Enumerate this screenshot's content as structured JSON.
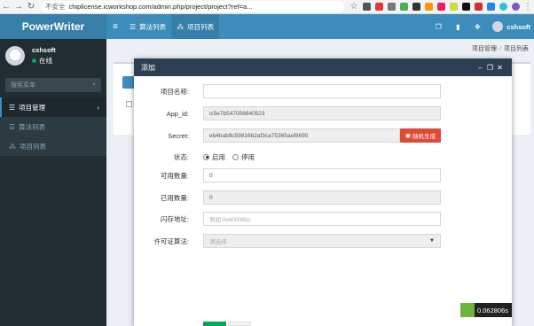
{
  "browser": {
    "security_label": "不安全",
    "url": "chiplicense.icworkshop.com/admin.php/project/project?ref=a..."
  },
  "sidebar": {
    "logo": "PowerWriter",
    "user_name": "cshsoft",
    "user_status": "在线",
    "search_placeholder": "搜索菜单",
    "menu": {
      "project_mgmt": "项目管理",
      "algo_list": "算法列表",
      "project_list": "项目列表"
    }
  },
  "topbar": {
    "tab_algo": "算法列表",
    "tab_project": "项目列表",
    "user": "cshsoft"
  },
  "breadcrumb": {
    "level1": "项目管理",
    "level2": "项目列表"
  },
  "modal": {
    "title": "添加",
    "fields": {
      "project_name_label": "项目名称:",
      "project_name_value": "",
      "app_id_label": "App_id:",
      "app_id_value": "ic5e7b547056840523",
      "secret_label": "Secret:",
      "secret_value": "eb4bab9c59816b2af3ca75365aef8695",
      "random_btn": "随机生成",
      "status_label": "状态:",
      "status_on": "启用",
      "status_off": "停用",
      "available_label": "可用数量:",
      "available_value": "0",
      "used_label": "已用数量:",
      "used_value": "0",
      "flash_label": "闪存地址:",
      "flash_placeholder": "例如:0x80008bc",
      "license_label": "许可证算法:",
      "license_placeholder": "请选择"
    }
  },
  "timer": "0.062806s"
}
